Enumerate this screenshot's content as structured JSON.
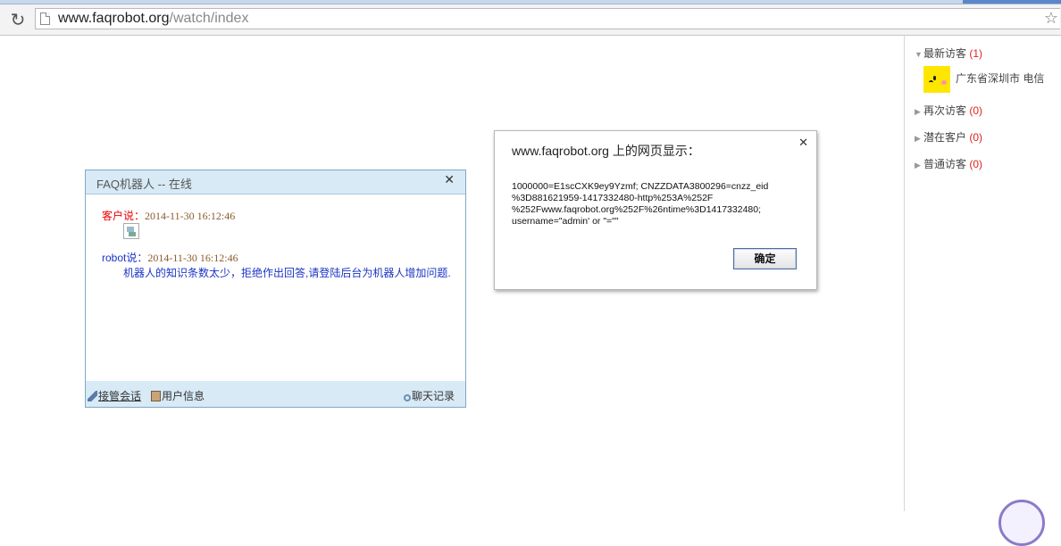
{
  "browser": {
    "url_host": "www.faqrobot.org",
    "url_path": "/watch/index",
    "reload_icon": "reload-icon",
    "bookmark_icon": "star-icon"
  },
  "sidebar": {
    "groups": [
      {
        "label": "最新访客",
        "count": "(1)",
        "expanded": true
      },
      {
        "label": "再次访客",
        "count": "(0)",
        "expanded": false
      },
      {
        "label": "潜在客户",
        "count": "(0)",
        "expanded": false
      },
      {
        "label": "普通访客",
        "count": "(0)",
        "expanded": false
      }
    ],
    "visitor": {
      "location": "广东省深圳市 电信"
    }
  },
  "chat": {
    "title": "FAQ机器人 -- 在线",
    "customer_label": "客户说：",
    "customer_time": "2014-11-30 16:12:46",
    "robot_label": "robot说：",
    "robot_time": "2014-11-30 16:12:46",
    "robot_text": "机器人的知识条数太少，拒绝作出回答,请登陆后台为机器人增加问题.",
    "footer": {
      "takeover": "接管会话",
      "user_info": "用户信息",
      "history": "聊天记录"
    }
  },
  "dialog": {
    "title": "www.faqrobot.org 上的网页显示：",
    "message": "1000000=E1scCXK9ey9Yzmf; CNZZDATA3800296=cnzz_eid\n%3D881621959-1417332480-http%253A%252F\n%252Fwww.faqrobot.org%252F%26ntime%3D1417332480;\nusername=\"admin' or \"=\"\"",
    "ok_label": "确定"
  },
  "colors": {
    "accent_blue": "#1a35c4",
    "count_red": "#dd2222",
    "header_bg": "#d7eaf6"
  }
}
